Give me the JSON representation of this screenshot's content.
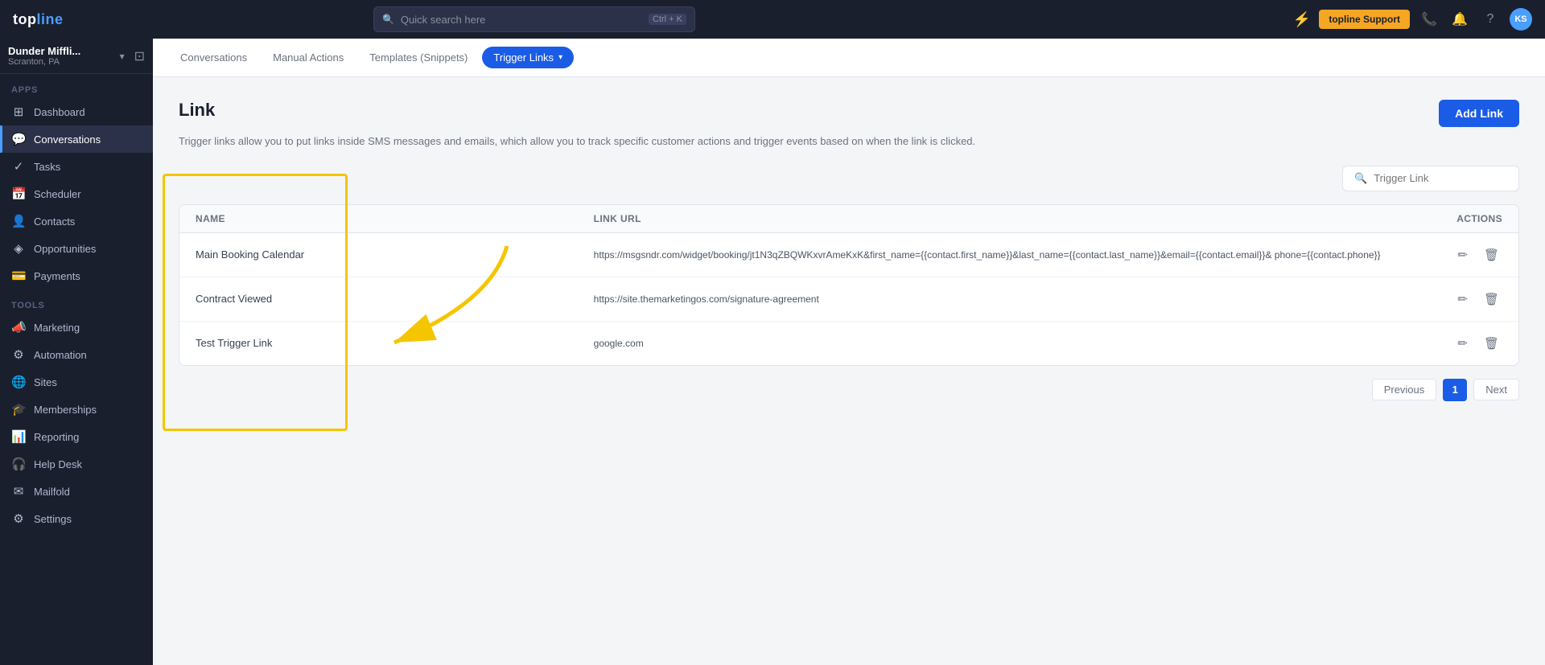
{
  "app": {
    "logo": "topline",
    "logo_accent": "line"
  },
  "topnav": {
    "search_placeholder": "Quick search here",
    "search_shortcut": "Ctrl + K",
    "lightning_icon": "⚡",
    "support_btn": "topline Support",
    "phone_icon": "📞",
    "bell_icon": "🔔",
    "help_icon": "?",
    "avatar": "KS"
  },
  "sidebar": {
    "workspace_name": "Dunder Miffli...",
    "workspace_sub": "Scranton, PA",
    "apps_label": "Apps",
    "tools_label": "Tools",
    "items": [
      {
        "id": "dashboard",
        "label": "Dashboard",
        "icon": "⊞"
      },
      {
        "id": "conversations",
        "label": "Conversations",
        "icon": "💬",
        "active": true
      },
      {
        "id": "tasks",
        "label": "Tasks",
        "icon": "✓"
      },
      {
        "id": "scheduler",
        "label": "Scheduler",
        "icon": "📅"
      },
      {
        "id": "contacts",
        "label": "Contacts",
        "icon": "👤"
      },
      {
        "id": "opportunities",
        "label": "Opportunities",
        "icon": "◈"
      },
      {
        "id": "payments",
        "label": "Payments",
        "icon": "💳"
      },
      {
        "id": "marketing",
        "label": "Marketing",
        "icon": "📣"
      },
      {
        "id": "automation",
        "label": "Automation",
        "icon": "⚙"
      },
      {
        "id": "sites",
        "label": "Sites",
        "icon": "🌐"
      },
      {
        "id": "memberships",
        "label": "Memberships",
        "icon": "🎓"
      },
      {
        "id": "reporting",
        "label": "Reporting",
        "icon": "📊"
      },
      {
        "id": "help-desk",
        "label": "Help Desk",
        "icon": "🎧"
      },
      {
        "id": "mailfold",
        "label": "Mailfold",
        "icon": "✉"
      },
      {
        "id": "settings",
        "label": "Settings",
        "icon": "⚙"
      }
    ]
  },
  "subnav": {
    "items": [
      {
        "id": "conversations",
        "label": "Conversations"
      },
      {
        "id": "manual-actions",
        "label": "Manual Actions"
      },
      {
        "id": "templates",
        "label": "Templates (Snippets)"
      },
      {
        "id": "trigger-links",
        "label": "Trigger Links",
        "active": true
      }
    ]
  },
  "page": {
    "title": "Link",
    "add_btn": "Add Link",
    "description": "Trigger links allow you to put links inside SMS messages and emails, which allow you to track specific customer actions and trigger events based on when the link is clicked.",
    "search_placeholder": "Trigger Link",
    "table": {
      "headers": [
        "Name",
        "Link URL",
        "Actions"
      ],
      "rows": [
        {
          "name": "Main Booking Calendar",
          "url": "https://msgsndr.com/widget/booking/jt1N3qZBQWKxvrAmeKxK&first_name={{contact.first_name}}&last_name={{contact.last_name}}&email={{contact.email}}& phone={{contact.phone}}"
        },
        {
          "name": "Contract Viewed",
          "url": "https://site.themarketingos.com/signature-agreement"
        },
        {
          "name": "Test Trigger Link",
          "url": "google.com"
        }
      ]
    },
    "pagination": {
      "prev": "Previous",
      "page": "1",
      "next": "Next"
    }
  },
  "highlight": {
    "names": [
      "Main Booking Calendar",
      "Contract Viewed",
      "Test Trigger Link"
    ]
  }
}
